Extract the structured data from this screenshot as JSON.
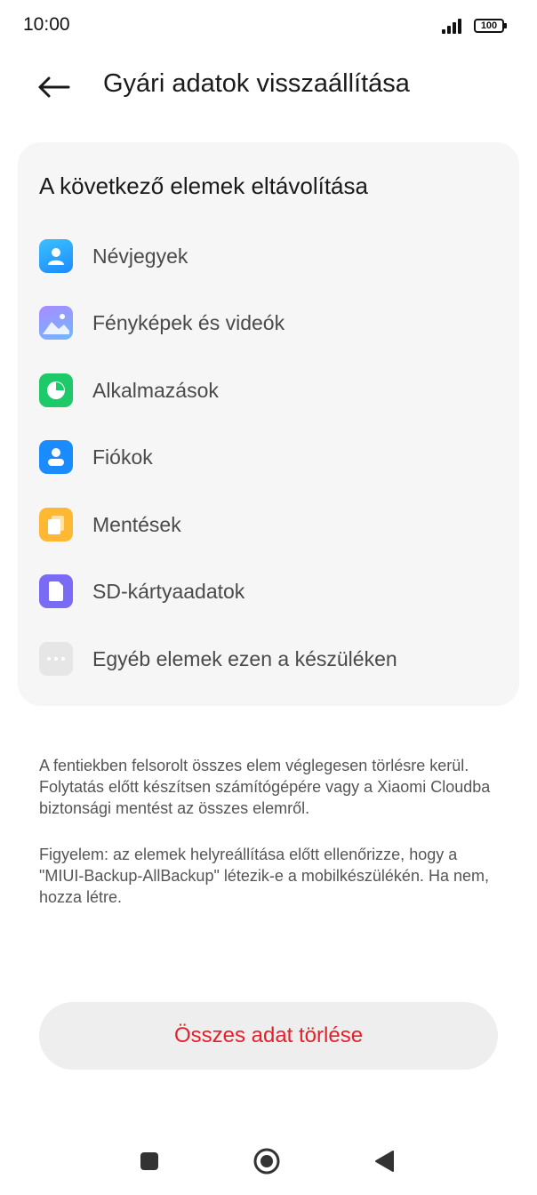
{
  "status_bar": {
    "time": "10:00",
    "battery": "100"
  },
  "header": {
    "title": "Gyári adatok visszaállítása",
    "back_icon": "arrow-left-icon"
  },
  "card": {
    "title": "A következő elemek eltávolítása",
    "items": [
      {
        "label": "Névjegyek",
        "icon": "contacts-icon",
        "color": "#1a9bff"
      },
      {
        "label": "Fényképek és videók",
        "icon": "gallery-icon",
        "color": "#8b8bff"
      },
      {
        "label": "Alkalmazások",
        "icon": "apps-icon",
        "color": "#1ec96a"
      },
      {
        "label": "Fiókok",
        "icon": "account-icon",
        "color": "#1a8cff"
      },
      {
        "label": "Mentések",
        "icon": "backup-icon",
        "color": "#ffb833"
      },
      {
        "label": "SD-kártyaadatok",
        "icon": "sd-card-icon",
        "color": "#7a6bf5"
      },
      {
        "label": "Egyéb elemek ezen a készüléken",
        "icon": "more-icon",
        "color": "#e6e6e6"
      }
    ]
  },
  "description": {
    "paragraph1": "A fentiekben felsorolt összes elem véglegesen törlésre kerül. Folytatás előtt készítsen számítógépére vagy a Xiaomi Cloudba biztonsági mentést az összes elemről.",
    "paragraph2": "Figyelem: az elemek helyreállítása előtt ellenőrizze, hogy a \"MIUI-Backup-AllBackup\" létezik-e a mobilkészülékén. Ha nem, hozza létre."
  },
  "action": {
    "delete_label": "Összes adat törlése",
    "color": "#e5202b"
  },
  "nav_bar": {
    "recent": "recent-apps-icon",
    "home": "home-icon",
    "back": "back-icon"
  }
}
